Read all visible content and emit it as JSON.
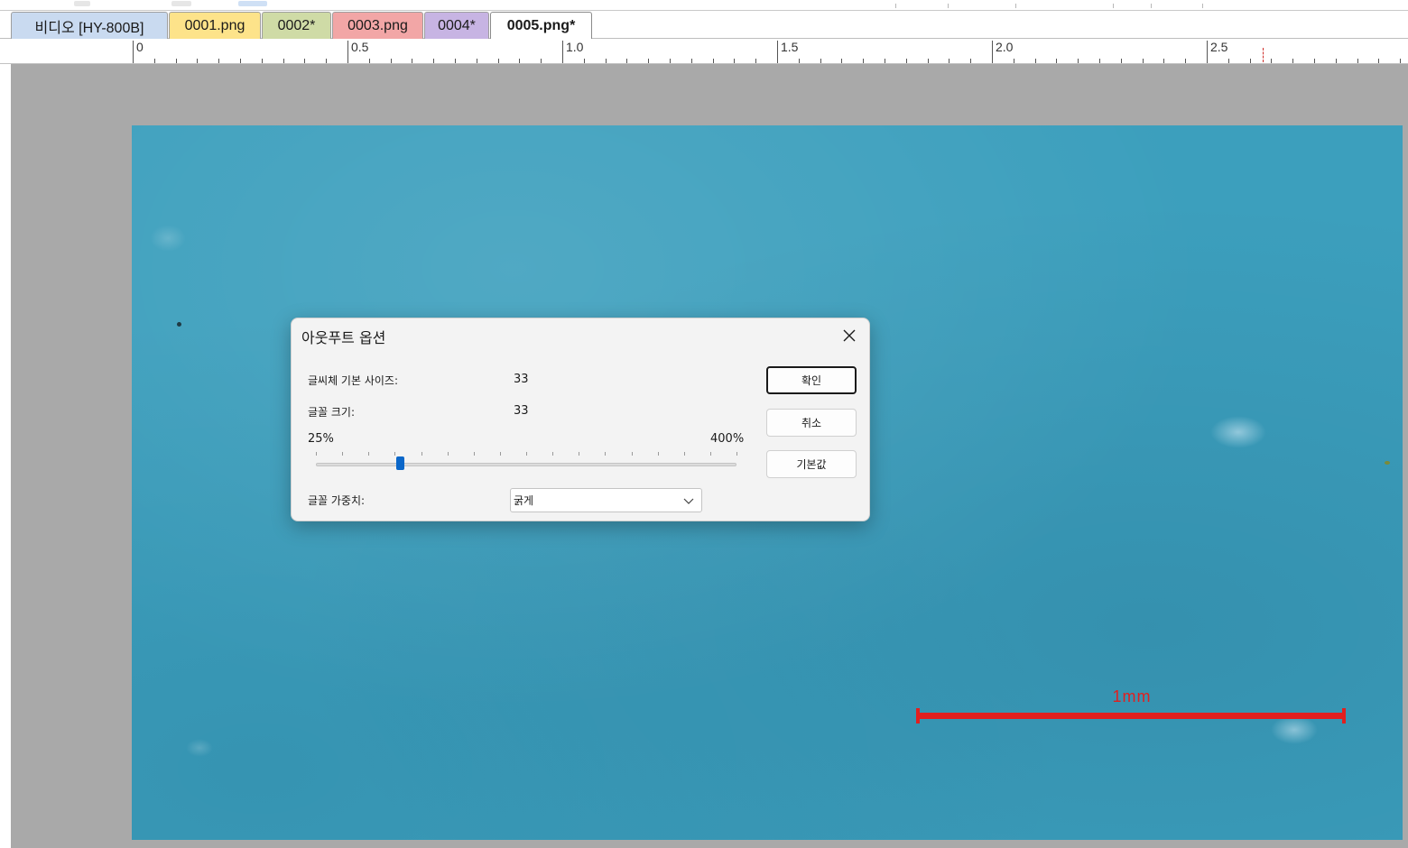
{
  "tabs": [
    {
      "label": "비디오 [HY-800B]",
      "color": "#c9daf0"
    },
    {
      "label": "0001.png",
      "color": "#fde38a"
    },
    {
      "label": "0002*",
      "color": "#cfdba6"
    },
    {
      "label": "0003.png",
      "color": "#f2a6a6"
    },
    {
      "label": "0004*",
      "color": "#c7b4e3"
    },
    {
      "label": "0005.png*",
      "color": "#ffffff",
      "active": true
    }
  ],
  "ruler": {
    "labels": [
      "0",
      "0.5",
      "1.0",
      "1.5",
      "2.0",
      "2.5"
    ],
    "marker_color": "#d0312d"
  },
  "canvas": {
    "image_color": "#3c9fbd",
    "workspace_color": "#a9a9a9",
    "scale_bar": {
      "label": "1mm",
      "color": "#e11f1f"
    }
  },
  "dialog": {
    "title": "아웃푸트 옵션",
    "base_font_size_label": "글씨체 기본 사이즈:",
    "base_font_size_value": "33",
    "font_size_label": "글꼴 크기:",
    "font_size_value": "33",
    "slider_min_label": "25%",
    "slider_max_label": "400%",
    "slider_fraction": 0.2,
    "font_weight_label": "글꼴 가중치:",
    "font_weight_value": "굵게",
    "ok_label": "확인",
    "cancel_label": "취소",
    "default_label": "기본값",
    "accent_color": "#0b67c9"
  },
  "icons": {
    "close": "close-icon",
    "dropdown": "chevron-down-icon"
  }
}
